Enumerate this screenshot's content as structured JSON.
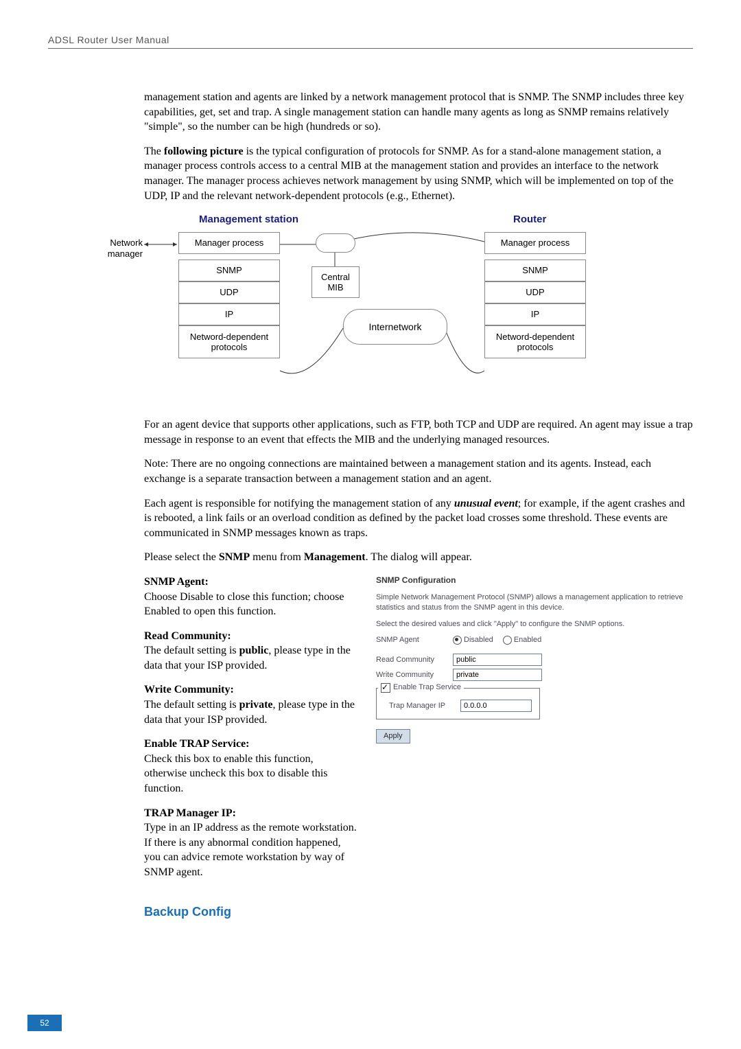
{
  "header": {
    "title": "ADSL Router User Manual"
  },
  "page_number": "52",
  "body": {
    "p1": "management station and agents are linked by a network management protocol that is SNMP. The SNMP includes three key capabilities, get, set and trap. A single management station can handle many agents as long as SNMP remains relatively \"simple\", so the number can be high (hundreds or so).",
    "p2a": "The ",
    "p2b": "following picture",
    "p2c": " is the typical configuration of protocols for SNMP. As for a stand-alone management station, a manager process controls access to a central MIB at the management station and provides an interface to the network manager. The manager process achieves network management by using SNMP, which will be implemented on top of the UDP, IP and the relevant network-dependent protocols (e.g., Ethernet).",
    "p3": "For an agent device that supports other applications, such as FTP, both TCP and UDP are required. An agent may issue a trap message in response to an event that effects the MIB and the underlying managed resources.",
    "p4": "Note: There are no ongoing connections are maintained between a management station and its agents. Instead, each exchange is a separate transaction between a management station and an agent.",
    "p5a": "Each agent is responsible for notifying the management station of any ",
    "p5b": "unusual event",
    "p5c": "; for example, if the agent crashes and is rebooted, a link fails or an overload condition as defined by the packet load crosses some threshold. These events are communicated in SNMP messages known as traps.",
    "p6a": "Please select the ",
    "p6b": "SNMP",
    "p6c": " menu from ",
    "p6d": "Management",
    "p6e": ". The dialog will appear."
  },
  "diagram": {
    "title_left": "Management station",
    "title_right": "Router",
    "net_mgr_l1": "Network",
    "net_mgr_l2": "manager",
    "left_stack": [
      "Manager process",
      "SNMP",
      "UDP",
      "IP"
    ],
    "left_bottom_l1": "Netword-dependent",
    "left_bottom_l2": "protocols",
    "right_stack": [
      "Manager process",
      "SNMP",
      "UDP",
      "IP"
    ],
    "right_bottom_l1": "Netword-dependent",
    "right_bottom_l2": "protocols",
    "mib_l1": "Central",
    "mib_l2": "MIB",
    "internet": "Internetwork"
  },
  "left_sections": {
    "agent_h": "SNMP Agent:",
    "agent_b": "Choose Disable to close this function; choose Enabled to open this function.",
    "readc_h": "Read Community:",
    "readc_b1": "The default setting is ",
    "readc_b2": "public",
    "readc_b3": ", please type in the data that your ISP provided.",
    "writec_h": "Write Community:",
    "writec_b1": "The default setting is ",
    "writec_b2": "private",
    "writec_b3": ", please type in the data that your ISP provided.",
    "trap_h": "Enable TRAP Service:",
    "trap_b": "Check this box to enable this function, otherwise uncheck this box to disable this function.",
    "mgr_h": "TRAP Manager IP:",
    "mgr_b": "Type in an IP address as the remote workstation. If there is any abnormal condition happened, you can advice remote workstation by way of SNMP agent."
  },
  "panel": {
    "title": "SNMP Configuration",
    "desc": "Simple Network Management Protocol (SNMP) allows a management application to retrieve statistics and status from the SNMP agent in this device.",
    "hint": "Select the desired values and click \"Apply\" to configure the SNMP options.",
    "row_agent": "SNMP Agent",
    "radio_disabled": "Disabled",
    "radio_enabled": "Enabled",
    "row_read": "Read Community",
    "val_read": "public",
    "row_write": "Write Community",
    "val_write": "private",
    "trap_legend": "Enable Trap Service",
    "row_trapip": "Trap Manager IP",
    "val_trapip": "0.0.0.0",
    "apply": "Apply"
  },
  "h2_backup": "Backup Config"
}
